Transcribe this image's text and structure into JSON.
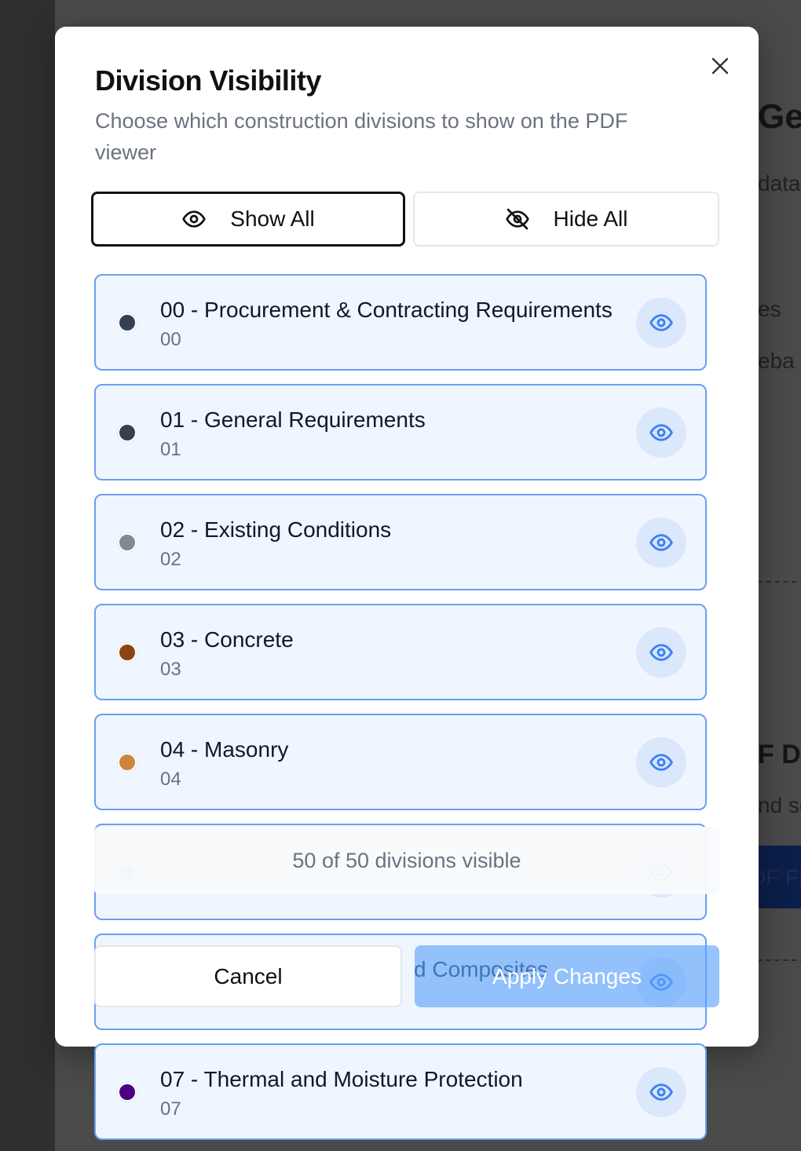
{
  "background": {
    "heading_1": "Ge",
    "line_1": "data",
    "line_2": "es",
    "line_3": "eba",
    "heading_2": "F Dr",
    "line_4": "nd se",
    "button_label": "DF Fi"
  },
  "modal": {
    "title": "Division Visibility",
    "description": "Choose which construction divisions to show on the PDF viewer",
    "show_all_label": "Show All",
    "hide_all_label": "Hide All",
    "counter": "50 of 50 divisions visible",
    "cancel_label": "Cancel",
    "apply_label": "Apply Changes"
  },
  "icons": {
    "close": "close-icon",
    "show_all": "eye-icon",
    "hide_all": "eye-off-icon",
    "toggle": "eye-icon"
  },
  "divisions": [
    {
      "name": "00 - Procurement & Contracting Requirements",
      "code": "00",
      "color": "#334155"
    },
    {
      "name": "01 - General Requirements",
      "code": "01",
      "color": "#334155"
    },
    {
      "name": "02 - Existing Conditions",
      "code": "02",
      "color": "#7f8c8d"
    },
    {
      "name": "03 - Concrete",
      "code": "03",
      "color": "#8b4513"
    },
    {
      "name": "04 - Masonry",
      "code": "04",
      "color": "#cd853f"
    },
    {
      "name": "",
      "code": "",
      "color": "#94a3b8"
    },
    {
      "name": "d Composites",
      "code": "",
      "color": "#94a3b8"
    },
    {
      "name": "07 - Thermal and Moisture Protection",
      "code": "07",
      "color": "#4b0082"
    }
  ],
  "colors": {
    "accent": "#3b82f6",
    "row_bg": "#eff6ff",
    "row_border": "#6b9ef0"
  }
}
